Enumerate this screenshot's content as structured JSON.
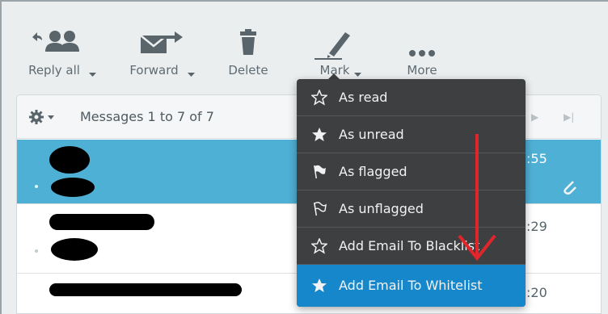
{
  "toolbar": {
    "reply_all_label": "Reply all",
    "forward_label": "Forward",
    "delete_label": "Delete",
    "mark_label": "Mark",
    "more_label": "More"
  },
  "message_list": {
    "count_text": "Messages 1 to 7 of 7",
    "rows": [
      {
        "time": ":55",
        "selected": true,
        "has_attachment": true
      },
      {
        "time": ":29",
        "selected": false,
        "has_attachment": false
      },
      {
        "time": ":20",
        "selected": false,
        "has_attachment": false
      }
    ]
  },
  "mark_menu": {
    "items": [
      {
        "label": "As read",
        "icon": "star-outline-icon"
      },
      {
        "label": "As unread",
        "icon": "star-filled-icon"
      },
      {
        "label": "As flagged",
        "icon": "flag-filled-icon"
      },
      {
        "label": "As unflagged",
        "icon": "flag-outline-icon"
      },
      {
        "label": "Add Email To Blacklist",
        "icon": "star-outline-icon"
      },
      {
        "label": "Add Email To Whitelist",
        "icon": "star-filled-icon",
        "active": true
      }
    ]
  },
  "colors": {
    "selected_row": "#4fb0d6",
    "menu_background": "#3d3f41",
    "menu_active": "#1787cb",
    "annotation_arrow": "#e0252b"
  }
}
